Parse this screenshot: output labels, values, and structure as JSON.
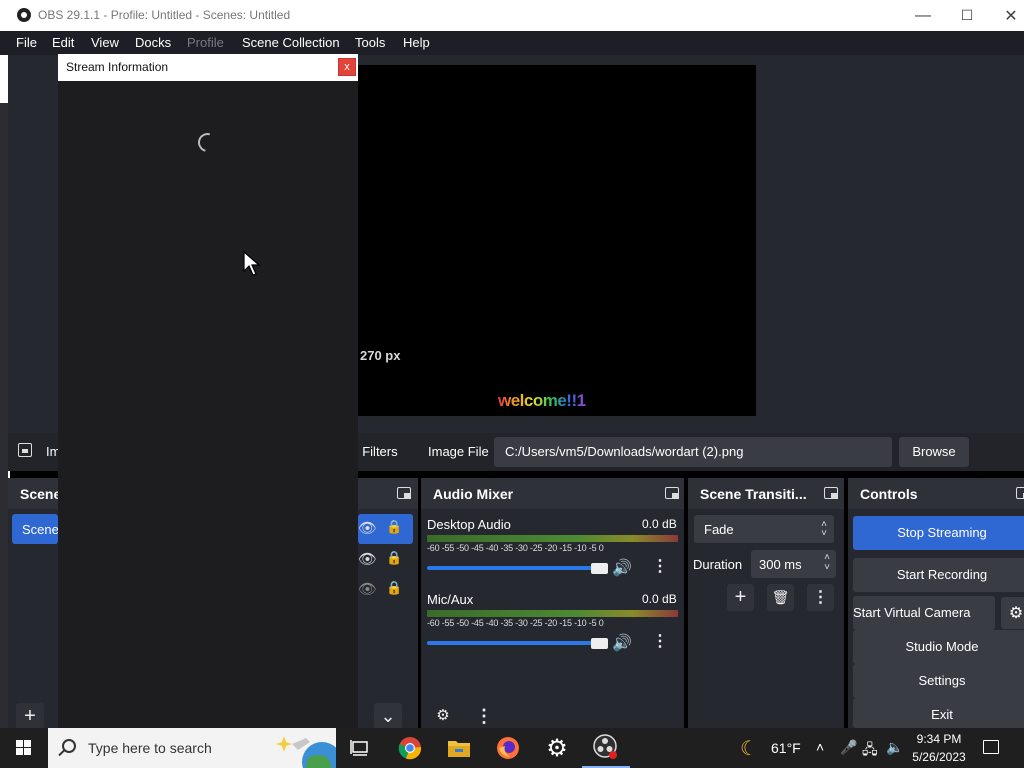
{
  "window": {
    "title": "OBS 29.1.1 - Profile: Untitled - Scenes: Untitled"
  },
  "menu": [
    "File",
    "Edit",
    "View",
    "Docks",
    "Profile",
    "Scene Collection",
    "Tools",
    "Help"
  ],
  "preview": {
    "size_label": "270 px",
    "wordart_text": "welcome!!1"
  },
  "properties_bar": {
    "source_name": "Im",
    "filters_label": "] Filters",
    "image_file_label": "Image File",
    "image_file_value": "C:/Users/vm5/Downloads/wordart (2).png",
    "browse_label": "Browse"
  },
  "scenes_dock": {
    "title": "Scene",
    "items": [
      "Scene"
    ]
  },
  "audio_mixer": {
    "title": "Audio Mixer",
    "channels": [
      {
        "name": "Desktop Audio",
        "level": "0.0 dB",
        "ticks": "-60 -55 -50 -45 -40 -35 -30 -25 -20 -15 -10 -5 0"
      },
      {
        "name": "Mic/Aux",
        "level": "0.0 dB",
        "ticks": "-60 -55 -50 -45 -40 -35 -30 -25 -20 -15 -10 -5 0"
      }
    ]
  },
  "transitions": {
    "title": "Scene Transiti...",
    "selected": "Fade",
    "duration_label": "Duration",
    "duration_value": "300 ms"
  },
  "controls": {
    "title": "Controls",
    "buttons": [
      "Stop Streaming",
      "Start Recording",
      "Start Virtual Camera",
      "Studio Mode",
      "Settings",
      "Exit"
    ]
  },
  "dialog": {
    "title": "Stream Information",
    "close": "x"
  },
  "taskbar": {
    "search_placeholder": "Type here to search",
    "weather_temp": "61°F",
    "time": "9:34 PM",
    "date": "5/26/2023"
  },
  "colors": {
    "accent": "#2f67d3",
    "dock_bg": "#26282f",
    "menu_bg": "#1e1f26"
  }
}
